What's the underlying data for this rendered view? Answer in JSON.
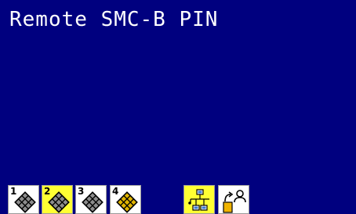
{
  "screen": {
    "title": "Remote SMC-B PIN"
  },
  "toolbar": {
    "slots": [
      {
        "number": "1",
        "icon": "smartcard-chip-icon",
        "active": false,
        "background": "#ffffff",
        "chip_color": "#8c8c8c"
      },
      {
        "number": "2",
        "icon": "smartcard-chip-icon",
        "active": true,
        "background": "#ffff33",
        "chip_color": "#8c8c8c"
      },
      {
        "number": "3",
        "icon": "smartcard-chip-icon",
        "active": false,
        "background": "#ffffff",
        "chip_color": "#8c8c8c"
      },
      {
        "number": "4",
        "icon": "smartcard-chip-icon",
        "active": false,
        "background": "#ffffff",
        "chip_color": "#e0b400"
      }
    ],
    "network": {
      "icon": "network-icon",
      "active": true,
      "background": "#ffff33"
    },
    "remote_user": {
      "icon": "remote-user-icon",
      "active": false,
      "background": "#ffffff"
    }
  },
  "colors": {
    "screen_background": "#00007f",
    "text": "#ffffff",
    "highlight": "#ffff33"
  }
}
